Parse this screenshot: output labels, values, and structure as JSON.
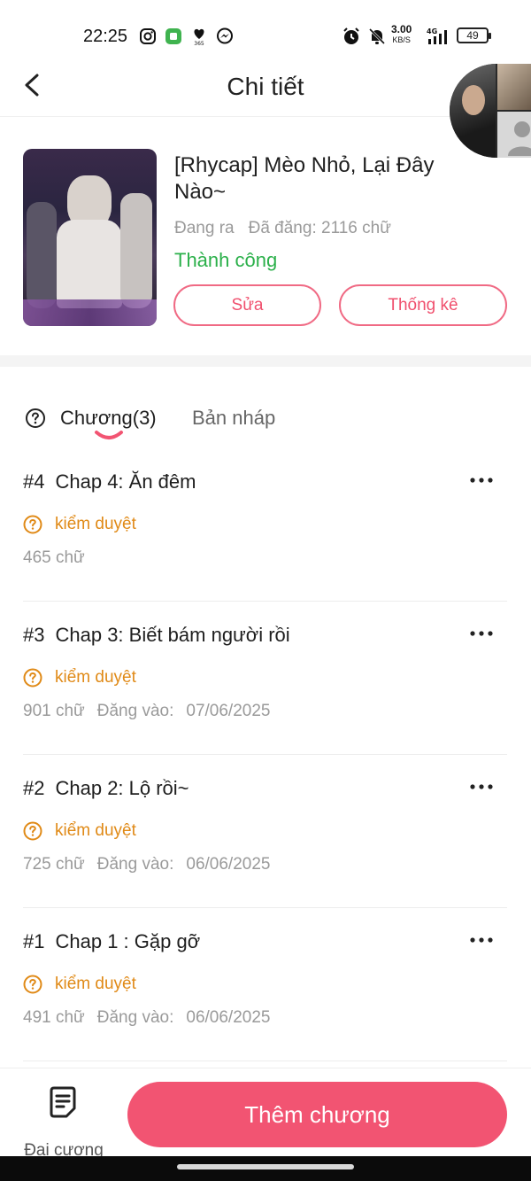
{
  "status_bar": {
    "time": "22:25",
    "icons": [
      "instagram-icon",
      "app-icon",
      "heart-365-icon",
      "messenger-icon",
      "alarm-icon",
      "mute-bell-icon",
      "signal-icon"
    ],
    "net_speed": "3.00",
    "net_unit": "KB/S",
    "net_type": "4G",
    "battery": "49"
  },
  "header": {
    "title": "Chi tiết"
  },
  "book": {
    "title": "[Rhycap] Mèo Nhỏ, Lại Đây Nào~",
    "state": "Đang ra",
    "word_count": "Đã đăng: 2116 chữ",
    "status": "Thành công",
    "edit_label": "Sửa",
    "stats_label": "Thống kê"
  },
  "tabs": {
    "chapters_label": "Chương(3)",
    "drafts_label": "Bản nháp"
  },
  "chapters": [
    {
      "number": "#4",
      "title": "Chap 4: Ăn đêm",
      "status": "kiểm duyệt",
      "words": "465 chữ",
      "posted_label": "",
      "posted_date": ""
    },
    {
      "number": "#3",
      "title": "Chap 3: Biết bám người rồi",
      "status": "kiểm duyệt",
      "words": "901 chữ",
      "posted_label": "Đăng vào:",
      "posted_date": "07/06/2025"
    },
    {
      "number": "#2",
      "title": "Chap 2: Lộ rồi~",
      "status": "kiểm duyệt",
      "words": "725 chữ",
      "posted_label": "Đăng vào:",
      "posted_date": "06/06/2025"
    },
    {
      "number": "#1",
      "title": "Chap 1 : Gặp gỡ",
      "status": "kiểm duyệt",
      "words": "491 chữ",
      "posted_label": "Đăng vào:",
      "posted_date": "06/06/2025"
    }
  ],
  "bottom": {
    "outline_label": "Đại cương",
    "add_chapter_label": "Thêm chương"
  },
  "colors": {
    "accent": "#f25472",
    "success": "#2bb04a",
    "pending": "#e08a17"
  }
}
